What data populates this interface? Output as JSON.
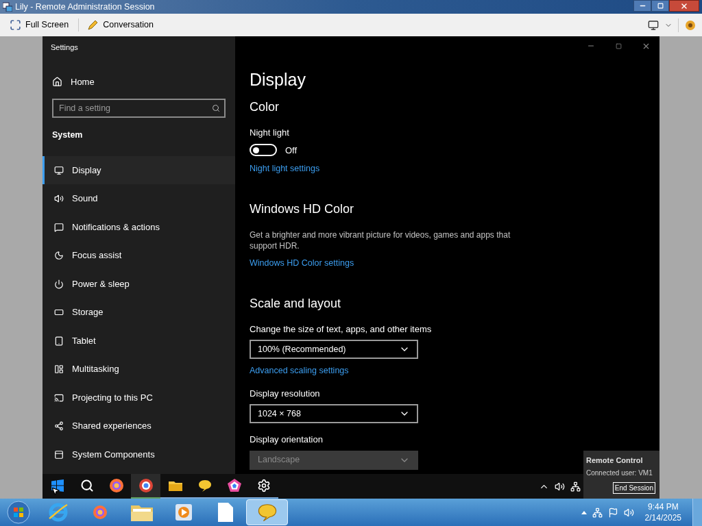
{
  "window": {
    "title": "Lily - Remote Administration Session"
  },
  "toolbar": {
    "buttons": [
      {
        "label": "Full Screen"
      },
      {
        "label": "Conversation"
      }
    ]
  },
  "settings": {
    "title": "Settings",
    "home": "Home",
    "search": {
      "placeholder": "Find a setting"
    },
    "section": "System",
    "nav": [
      {
        "label": "Display",
        "selected": true
      },
      {
        "label": "Sound",
        "selected": false
      },
      {
        "label": "Notifications & actions",
        "selected": false
      },
      {
        "label": "Focus assist",
        "selected": false
      },
      {
        "label": "Power & sleep",
        "selected": false
      },
      {
        "label": "Storage",
        "selected": false
      },
      {
        "label": "Tablet",
        "selected": false
      },
      {
        "label": "Multitasking",
        "selected": false
      },
      {
        "label": "Projecting to this PC",
        "selected": false
      },
      {
        "label": "Shared experiences",
        "selected": false
      },
      {
        "label": "System Components",
        "selected": false
      }
    ],
    "page_title": "Display",
    "content": [
      {
        "kind": "heading",
        "text": "Color"
      },
      {
        "kind": "label",
        "text": "Night light"
      },
      {
        "kind": "toggle",
        "on": false,
        "text": "Off"
      },
      {
        "kind": "link",
        "text": "Night light settings"
      },
      {
        "kind": "heading",
        "text": "Windows HD Color"
      },
      {
        "kind": "paragraph",
        "text": "Get a brighter and more vibrant picture for videos, games and apps that support HDR."
      },
      {
        "kind": "link",
        "text": "Windows HD Color settings"
      },
      {
        "kind": "heading",
        "text": "Scale and layout"
      },
      {
        "kind": "label",
        "text": "Change the size of text, apps, and other items"
      },
      {
        "kind": "dropdown",
        "value": "100% (Recommended)",
        "disabled": false
      },
      {
        "kind": "link",
        "text": "Advanced scaling settings"
      },
      {
        "kind": "label",
        "text": "Display resolution"
      },
      {
        "kind": "dropdown",
        "value": "1024 × 768",
        "disabled": false
      },
      {
        "kind": "label",
        "text": "Display orientation"
      },
      {
        "kind": "dropdown",
        "value": "Landscape",
        "disabled": true
      }
    ]
  },
  "remote_taskbar": {
    "apps": [
      {
        "selected": false,
        "running": false
      },
      {
        "selected": false,
        "running": false
      },
      {
        "selected": false,
        "running": false
      },
      {
        "selected": true,
        "running": true
      },
      {
        "selected": false,
        "running": true
      },
      {
        "selected": false,
        "running": true
      },
      {
        "selected": false,
        "running": true
      },
      {
        "selected": false,
        "running": true
      }
    ]
  },
  "remote_popup": {
    "title": "Remote Control",
    "user": "Connected user: VM1",
    "button": "End Session"
  },
  "taskbar": {
    "apps": [
      {
        "selected": false
      },
      {
        "selected": false
      },
      {
        "selected": false
      },
      {
        "selected": false
      },
      {
        "selected": false
      },
      {
        "selected": true
      }
    ],
    "clock": {
      "time": "9:44 PM",
      "date": "2/14/2025"
    }
  }
}
